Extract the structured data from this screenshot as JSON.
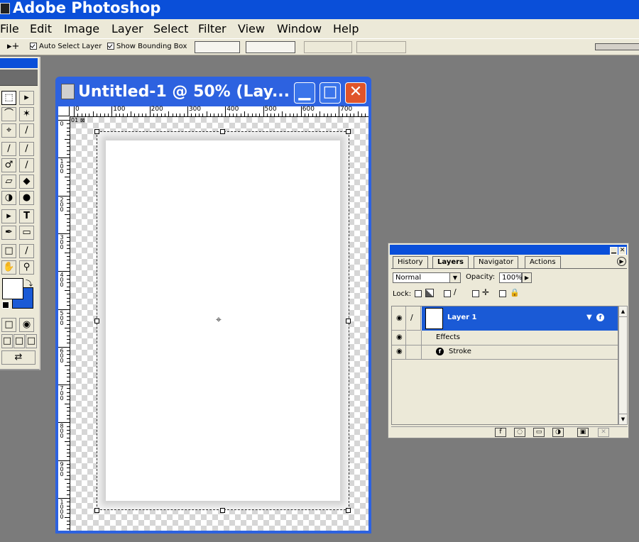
{
  "app": {
    "title": "Adobe Photoshop"
  },
  "menu": [
    "File",
    "Edit",
    "Image",
    "Layer",
    "Select",
    "Filter",
    "View",
    "Window",
    "Help"
  ],
  "options": {
    "auto_select": "Auto Select Layer",
    "bounding_box": "Show Bounding Box"
  },
  "document": {
    "title": "Untitled-1 @ 50% (Lay...",
    "h_ruler": [
      "0",
      "100",
      "200",
      "300",
      "400",
      "500",
      "600",
      "700"
    ],
    "v_ruler": [
      "0",
      "100",
      "200",
      "300",
      "400",
      "500",
      "600",
      "700",
      "800",
      "900",
      "1000"
    ]
  },
  "palette": {
    "tabs": [
      "History",
      "Layers",
      "Navigator",
      "Actions"
    ],
    "active_tab": "Layers",
    "blend_mode": "Normal",
    "opacity_label": "Opacity:",
    "opacity_value": "100%",
    "lock_label": "Lock:",
    "layer_name": "Layer 1",
    "effects_label": "Effects",
    "stroke_label": "Stroke"
  },
  "colors": {
    "xp_blue": "#0a4fd9",
    "selection_blue": "#1a5ad6",
    "close_red": "#e0542a",
    "panel_bg": "#ece9d8"
  }
}
